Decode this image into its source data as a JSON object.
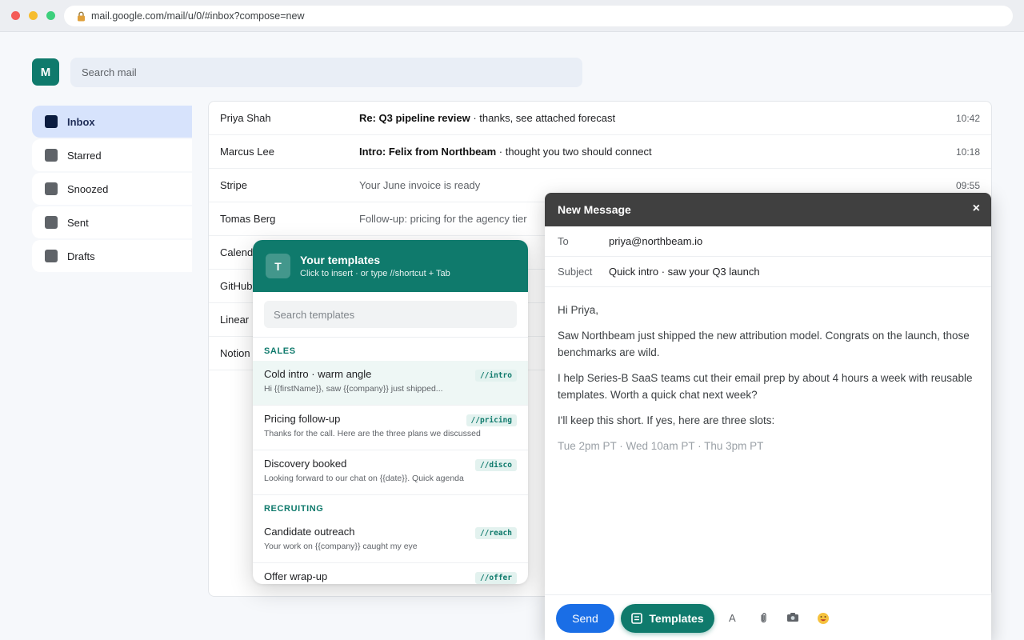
{
  "browser": {
    "url": "mail.google.com/mail/u/0/#inbox?compose=new"
  },
  "app": {
    "logo_letter": "M",
    "search_placeholder": "Search mail"
  },
  "sidebar": {
    "items": [
      {
        "label": "Inbox",
        "active": true
      },
      {
        "label": "Starred"
      },
      {
        "label": "Snoozed"
      },
      {
        "label": "Sent"
      },
      {
        "label": "Drafts"
      }
    ]
  },
  "mail": {
    "rows": [
      {
        "from": "Priya Shah",
        "subject": "Re: Q3 pipeline review",
        "snippet": " · thanks, see attached forecast",
        "time": "10:42",
        "unread": true
      },
      {
        "from": "Marcus Lee",
        "subject": "Intro: Felix from Northbeam",
        "snippet": " · thought you two should connect",
        "time": "10:18",
        "unread": true
      },
      {
        "from": "Stripe",
        "subject": "",
        "snippet": "Your June invoice is ready",
        "time": "09:55",
        "unread": false
      },
      {
        "from": "Tomas Berg",
        "subject": "",
        "snippet": "Follow-up: pricing for the agency tier",
        "time": "",
        "unread": false
      },
      {
        "from": "Calendly",
        "subject": "",
        "snippet": "",
        "time": "",
        "unread": false
      },
      {
        "from": "GitHub",
        "subject": "",
        "snippet": "",
        "time": "",
        "unread": false
      },
      {
        "from": "Linear",
        "subject": "",
        "snippet": "",
        "time": "",
        "unread": false
      },
      {
        "from": "Notion",
        "subject": "",
        "snippet": "",
        "time": "",
        "unread": false
      }
    ]
  },
  "templates": {
    "avatar_letter": "T",
    "title": "Your templates",
    "subtitle": "Click to insert · or type //shortcut + Tab",
    "search_placeholder": "Search templates",
    "sections": [
      {
        "name": "SALES",
        "items": [
          {
            "name": "Cold intro · warm angle",
            "shortcut": "//intro",
            "preview": "Hi {{firstName}}, saw {{company}} just shipped...",
            "highlighted": true
          },
          {
            "name": "Pricing follow-up",
            "shortcut": "//pricing",
            "preview": "Thanks for the call. Here are the three plans we discussed"
          },
          {
            "name": "Discovery booked",
            "shortcut": "//disco",
            "preview": "Looking forward to our chat on {{date}}. Quick agenda"
          }
        ]
      },
      {
        "name": "RECRUITING",
        "items": [
          {
            "name": "Candidate outreach",
            "shortcut": "//reach",
            "preview": "Your work on {{company}} caught my eye"
          },
          {
            "name": "Offer wrap-up",
            "shortcut": "//offer",
            "preview": ""
          }
        ]
      }
    ]
  },
  "compose": {
    "title": "New Message",
    "close": "×",
    "to_label": "To",
    "to_value": "priya@northbeam.io",
    "subject_label": "Subject",
    "subject_value": "Quick intro · saw your Q3 launch",
    "body": [
      "Hi Priya,",
      "Saw Northbeam just shipped the new attribution model. Congrats on the launch, those benchmarks are wild.",
      "I help Series-B SaaS teams cut their email prep by about 4 hours a week with reusable templates. Worth a quick chat next week?",
      "I'll keep this short. If yes, here are three slots:"
    ],
    "slots": "Tue 2pm PT · Wed 10am PT · Thu 3pm PT",
    "send_label": "Send",
    "templates_label": "Templates",
    "format_label": "A"
  },
  "colors": {
    "brand": "#0f7a6c",
    "send": "#1a6ee6",
    "compose_header": "#404040"
  }
}
